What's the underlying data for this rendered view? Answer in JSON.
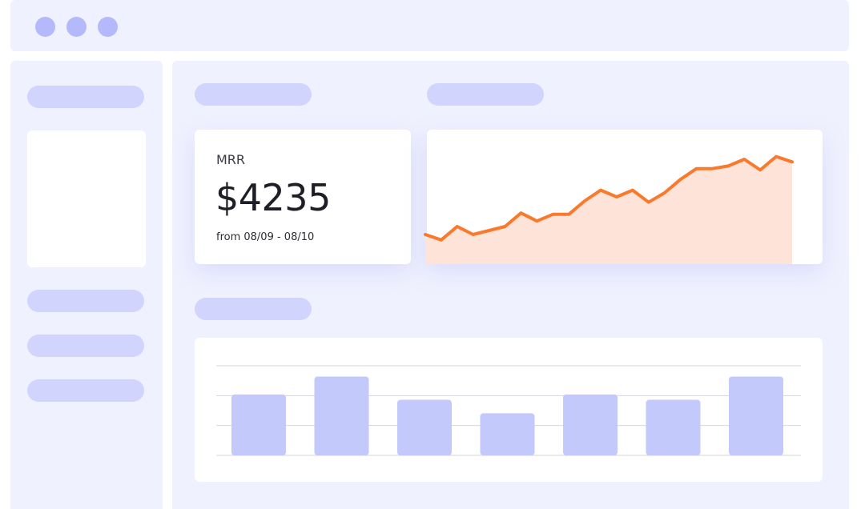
{
  "window": {
    "controls": [
      "window-dot-1",
      "window-dot-2",
      "window-dot-3"
    ]
  },
  "metric_card": {
    "label": "MRR",
    "value": "$4235",
    "range": "from 08/09 - 08/10"
  },
  "colors": {
    "window_bg": "#f0f1fe",
    "placeholder_pill": "#d1d5fd",
    "window_dot": "#b3b9fb",
    "line": "#f97a2d",
    "area_fill": "#fde3d8",
    "bar": "#c3c9fb",
    "gridline": "#d4d4dc"
  },
  "chart_data": [
    {
      "type": "area",
      "x": [
        0,
        1,
        2,
        3,
        4,
        5,
        6,
        7,
        8,
        9,
        10,
        11,
        12,
        13,
        14,
        15,
        16,
        17,
        18,
        19,
        20,
        21,
        22,
        23
      ],
      "values": [
        22,
        18,
        28,
        22,
        25,
        28,
        38,
        32,
        37,
        37,
        47,
        55,
        50,
        55,
        46,
        53,
        63,
        71,
        71,
        73,
        78,
        70,
        80,
        76
      ],
      "ylim": [
        0,
        100
      ]
    },
    {
      "type": "bar",
      "values": [
        68,
        88,
        62,
        47,
        68,
        62,
        88
      ],
      "ylim": [
        0,
        100
      ],
      "grid": true
    }
  ]
}
